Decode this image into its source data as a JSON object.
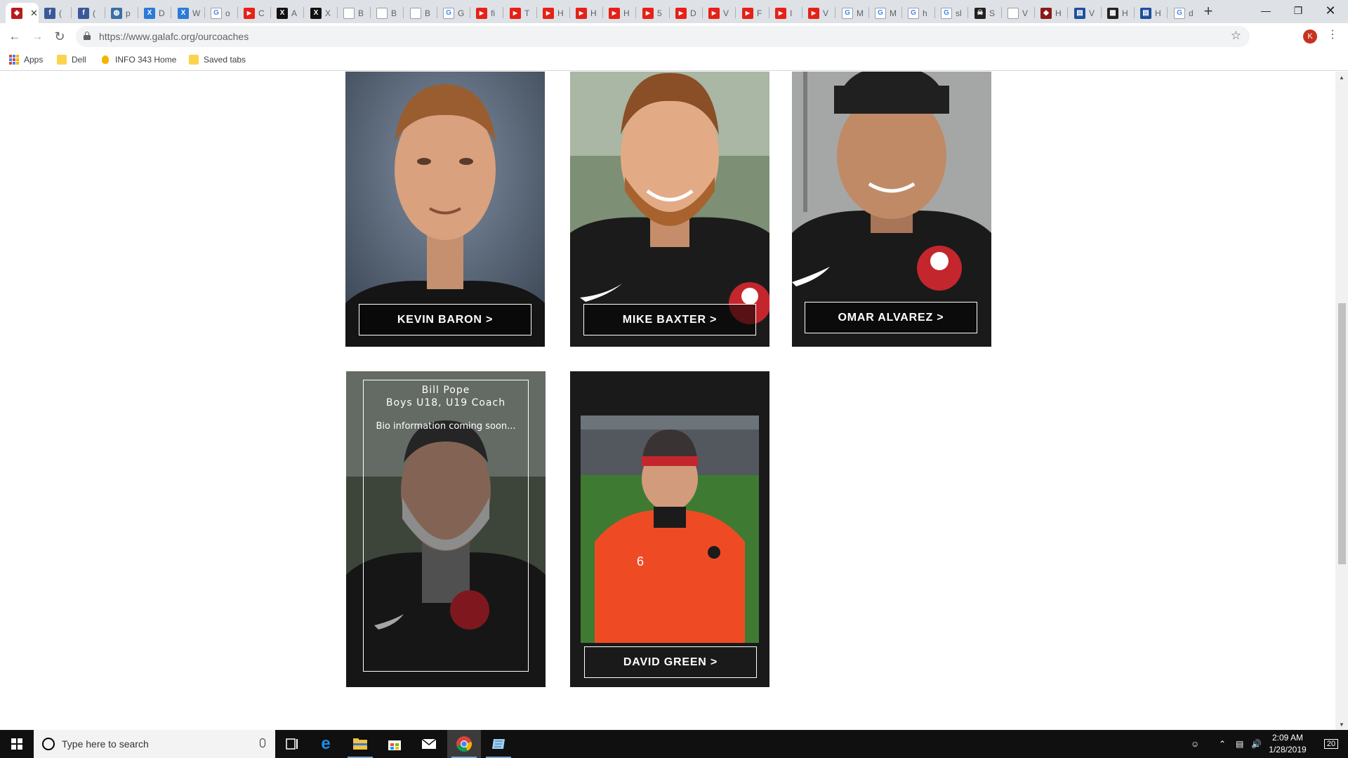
{
  "browser": {
    "tabs": [
      {
        "label": "",
        "favicon": "club-crest-icon",
        "color": "#b71c1c",
        "active": true
      },
      {
        "label": "(",
        "favicon": "facebook-icon",
        "color": "#3b5998"
      },
      {
        "label": "(",
        "favicon": "facebook-icon",
        "color": "#3b5998"
      },
      {
        "label": "p",
        "favicon": "globe-icon",
        "color": "#3a6ea5"
      },
      {
        "label": "D",
        "favicon": "x-doc-icon",
        "color": "#2b7bd6"
      },
      {
        "label": "W",
        "favicon": "x-doc-icon",
        "color": "#2b7bd6"
      },
      {
        "label": "o",
        "favicon": "google-icon",
        "color": "#ffffff"
      },
      {
        "label": "C",
        "favicon": "youtube-icon",
        "color": "#e62117"
      },
      {
        "label": "A",
        "favicon": "x-icon",
        "color": "#111111"
      },
      {
        "label": "X",
        "favicon": "x-icon",
        "color": "#111111"
      },
      {
        "label": "B",
        "favicon": "page-icon",
        "color": "#ffffff"
      },
      {
        "label": "B",
        "favicon": "page-icon",
        "color": "#ffffff"
      },
      {
        "label": "B",
        "favicon": "page-icon",
        "color": "#ffffff"
      },
      {
        "label": "G",
        "favicon": "google-icon",
        "color": "#ffffff"
      },
      {
        "label": "fi",
        "favicon": "youtube-icon",
        "color": "#e62117"
      },
      {
        "label": "T",
        "favicon": "youtube-icon",
        "color": "#e62117"
      },
      {
        "label": "H",
        "favicon": "youtube-icon",
        "color": "#e62117"
      },
      {
        "label": "H",
        "favicon": "youtube-icon",
        "color": "#e62117"
      },
      {
        "label": "H",
        "favicon": "youtube-icon",
        "color": "#e62117"
      },
      {
        "label": "5",
        "favicon": "youtube-icon",
        "color": "#e62117"
      },
      {
        "label": "D",
        "favicon": "youtube-icon",
        "color": "#e62117"
      },
      {
        "label": "V",
        "favicon": "youtube-icon",
        "color": "#e62117"
      },
      {
        "label": "F",
        "favicon": "youtube-icon",
        "color": "#e62117"
      },
      {
        "label": "I",
        "favicon": "youtube-icon",
        "color": "#e62117"
      },
      {
        "label": "V",
        "favicon": "youtube-icon",
        "color": "#e62117"
      },
      {
        "label": "M",
        "favicon": "google-icon",
        "color": "#ffffff"
      },
      {
        "label": "M",
        "favicon": "google-icon",
        "color": "#ffffff"
      },
      {
        "label": "h",
        "favicon": "google-icon",
        "color": "#ffffff"
      },
      {
        "label": "sl",
        "favicon": "google-icon",
        "color": "#ffffff"
      },
      {
        "label": "S",
        "favicon": "skull-icon",
        "color": "#222222"
      },
      {
        "label": "V",
        "favicon": "page-icon",
        "color": "#ffffff"
      },
      {
        "label": "H",
        "favicon": "club-crest-icon",
        "color": "#8b1a1a"
      },
      {
        "label": "V",
        "favicon": "chart-icon",
        "color": "#1f4e9c"
      },
      {
        "label": "H",
        "favicon": "image-icon",
        "color": "#222222"
      },
      {
        "label": "H",
        "favicon": "chart-icon",
        "color": "#1f4e9c"
      },
      {
        "label": "d",
        "favicon": "google-icon",
        "color": "#ffffff"
      }
    ],
    "url": "https://www.galafc.org/ourcoaches",
    "profile_initial": "K",
    "bookmarks": [
      {
        "label": "Apps",
        "icon": "apps-grid-icon"
      },
      {
        "label": "Dell",
        "icon": "folder-icon"
      },
      {
        "label": "INFO 343 Home",
        "icon": "lightbulb-icon"
      },
      {
        "label": "Saved tabs",
        "icon": "folder-icon"
      }
    ]
  },
  "coaches": [
    {
      "name": "KEVIN BARON  >",
      "photo": "kevin"
    },
    {
      "name": "MIKE BAXTER  >",
      "photo": "mike"
    },
    {
      "name": "OMAR ALVAREZ  >",
      "photo": "omar"
    },
    {
      "name": "Bill Pope",
      "role": "Boys U18, U19 Coach",
      "bio": "Bio information coming soon...",
      "photo": "bill"
    },
    {
      "name": "DAVID GREEN  >",
      "photo": "david"
    }
  ],
  "taskbar": {
    "search_placeholder": "Type here to search",
    "time": "2:09 AM",
    "date": "1/28/2019",
    "notifications": "20"
  }
}
